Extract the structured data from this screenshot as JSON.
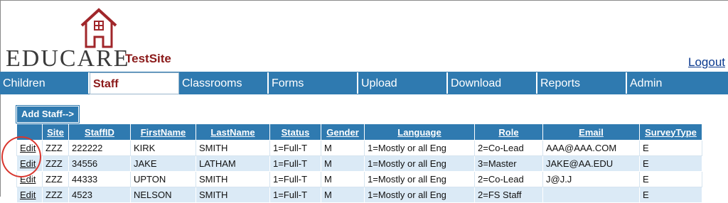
{
  "brand": {
    "logo_text": "EDUCARE",
    "site_name": "TestSite"
  },
  "header": {
    "logout_label": "Logout"
  },
  "nav": {
    "items": [
      {
        "label": "Children"
      },
      {
        "label": "Staff",
        "active": true
      },
      {
        "label": "Classrooms"
      },
      {
        "label": "Forms"
      },
      {
        "label": "Upload"
      },
      {
        "label": "Download"
      },
      {
        "label": "Reports"
      },
      {
        "label": "Admin"
      }
    ]
  },
  "toolbar": {
    "add_staff_label": "Add Staff-->"
  },
  "table": {
    "columns": [
      "",
      "Site",
      "StaffID",
      "FirstName",
      "LastName",
      "Status",
      "Gender",
      "Language",
      "Role",
      "Email",
      "SurveyType"
    ],
    "rows": [
      {
        "edit": "Edit",
        "site": "ZZZ",
        "staff_id": "222222",
        "first": "KIRK",
        "last": "SMITH",
        "status": "1=Full-T",
        "gender": "M",
        "language": "1=Mostly or all Eng",
        "role": "2=Co-Lead",
        "email": "AAA@AAA.COM",
        "survey": "E"
      },
      {
        "edit": "Edit",
        "site": "ZZZ",
        "staff_id": "34556",
        "first": "JAKE",
        "last": "LATHAM",
        "status": "1=Full-T",
        "gender": "M",
        "language": "1=Mostly or all Eng",
        "role": "3=Master",
        "email": "JAKE@AA.EDU",
        "survey": "E"
      },
      {
        "edit": "Edit",
        "site": "ZZZ",
        "staff_id": "44333",
        "first": "UPTON",
        "last": "SMITH",
        "status": "1=Full-T",
        "gender": "M",
        "language": "1=Mostly or all Eng",
        "role": "2=Co-Lead",
        "email": "J@J.J",
        "survey": "E"
      },
      {
        "edit": "Edit",
        "site": "ZZZ",
        "staff_id": "4523",
        "first": "NELSON",
        "last": "SMITH",
        "status": "1=Full-T",
        "gender": "M",
        "language": "1=Mostly or all Eng",
        "role": "2=FS Staff",
        "email": "",
        "survey": "E"
      }
    ]
  },
  "colors": {
    "nav_blue": "#2f7ab0",
    "brand_red": "#8b1a1a",
    "row_alt": "#dbeaf6",
    "highlight_circle": "#d9362e"
  }
}
